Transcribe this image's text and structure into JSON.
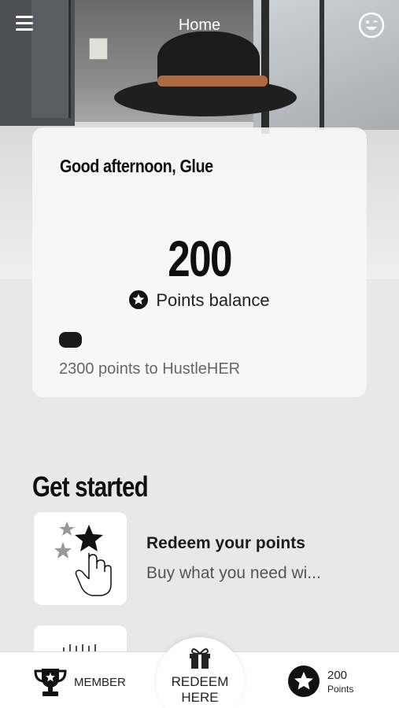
{
  "header": {
    "title": "Home",
    "menu_icon": "menu-icon",
    "profile_icon": "smiley-icon"
  },
  "balance_card": {
    "greeting": "Good afternoon, Glue",
    "points": "200",
    "points_label": "Points balance",
    "progress_fraction": 0.08,
    "next_tier_text": "2300 points to HustleHER"
  },
  "get_started": {
    "title": "Get started",
    "items": [
      {
        "title": "Redeem your points",
        "description": "Buy what you need wi..."
      }
    ]
  },
  "bottom_nav": {
    "member_label": "MEMBER",
    "redeem_label_line1": "REDEEM",
    "redeem_label_line2": "HERE",
    "points_value": "200",
    "points_label": "Points"
  },
  "colors": {
    "accent": "#111111",
    "background": "#e8e8e8",
    "card": "#f8f8f8"
  }
}
